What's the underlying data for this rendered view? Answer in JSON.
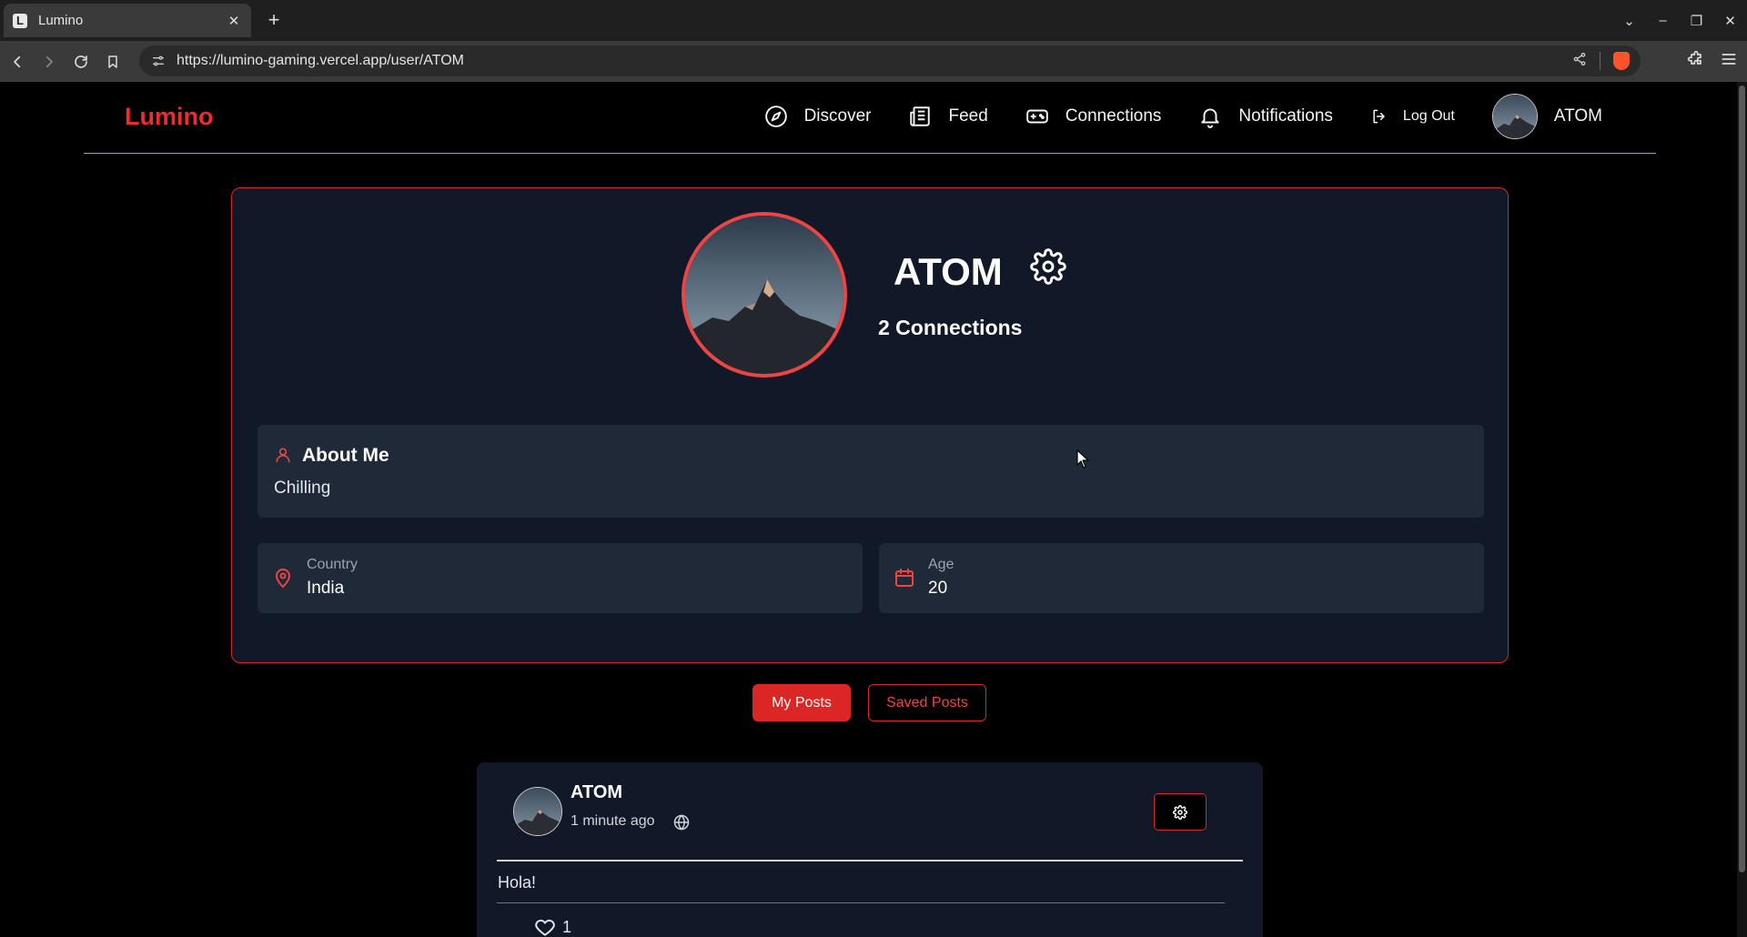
{
  "browser": {
    "tab_title": "Lumino",
    "tab_favicon": "L",
    "url": "https://lumino-gaming.vercel.app/user/ATOM"
  },
  "header": {
    "logo": "Lumino",
    "nav": [
      {
        "label": "Discover",
        "icon": "compass-icon"
      },
      {
        "label": "Feed",
        "icon": "newspaper-icon"
      },
      {
        "label": "Connections",
        "icon": "gamepad-icon"
      },
      {
        "label": "Notifications",
        "icon": "bell-icon"
      },
      {
        "label": "Log Out",
        "icon": "logout-icon"
      }
    ],
    "username": "ATOM"
  },
  "profile": {
    "name": "ATOM",
    "connections": "2 Connections",
    "about_title": "About Me",
    "about_text": "Chilling",
    "country_label": "Country",
    "country_value": "India",
    "age_label": "Age",
    "age_value": "20"
  },
  "tabs": {
    "my_posts": "My Posts",
    "saved_posts": "Saved Posts",
    "active": "My Posts"
  },
  "post": {
    "author": "ATOM",
    "time": "1 minute ago",
    "visibility_icon": "globe-icon",
    "content": "Hola!",
    "likes": "1"
  },
  "colors": {
    "accent": "#dc2626",
    "logo": "#ef2b2d",
    "card_bg": "#111827",
    "panel_bg": "#1f2937",
    "page_bg": "#000000"
  }
}
